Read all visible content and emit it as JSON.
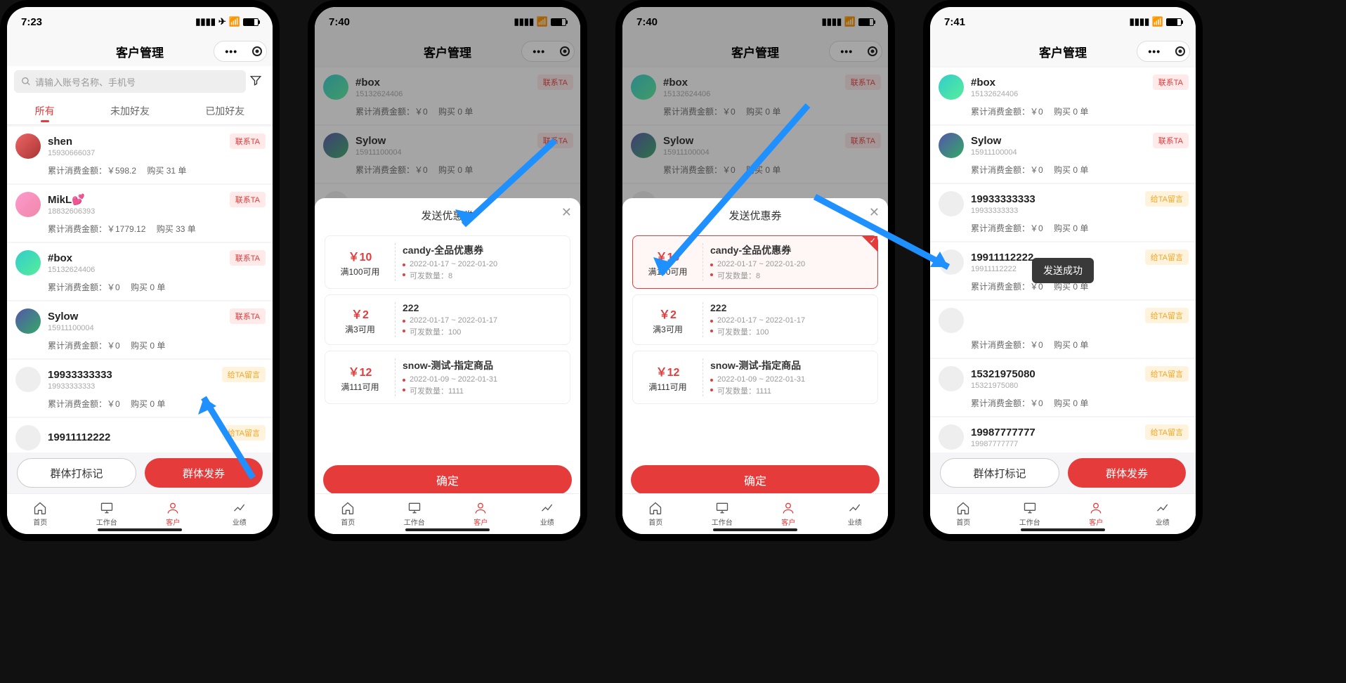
{
  "page_title": "客户管理",
  "statusbar": {
    "times": [
      "7:23",
      "7:40",
      "7:40",
      "7:41"
    ]
  },
  "search": {
    "placeholder": "请输入账号名称、手机号"
  },
  "tabs": {
    "all": "所有",
    "not_friend": "未加好友",
    "friend": "已加好友"
  },
  "badges": {
    "contact": "联系TA",
    "message": "给TA留言"
  },
  "sum_labels": {
    "spend": "累计消费金额：",
    "orders_prefix": "购买 ",
    "orders_suffix": " 单"
  },
  "bottom_buttons": {
    "tag": "群体打标记",
    "send": "群体发券"
  },
  "tabbar": {
    "home": "首页",
    "workbench": "工作台",
    "customer": "客户",
    "performance": "业绩"
  },
  "sheet": {
    "title": "发送优惠券",
    "confirm": "确定"
  },
  "toast": "发送成功",
  "currency": "￥",
  "coupon_prefix": "满",
  "coupon_suffix": "可用",
  "coupon_meta": {
    "date_label_sep": "~",
    "qty_label": "可发数量："
  },
  "customers_s1": [
    {
      "name": "shen",
      "phone": "15930666037",
      "spend": "598.2",
      "orders": "31",
      "badge": "contact",
      "avatar": "c1"
    },
    {
      "name": "MikL💕",
      "phone": "18832606393",
      "spend": "1779.12",
      "orders": "33",
      "badge": "contact",
      "avatar": "c2"
    },
    {
      "name": "#box",
      "phone": "15132624406",
      "spend": "0",
      "orders": "0",
      "badge": "contact",
      "avatar": "c3"
    },
    {
      "name": "Sylow",
      "phone": "15911100004",
      "spend": "0",
      "orders": "0",
      "badge": "contact",
      "avatar": "c4"
    },
    {
      "name": "19933333333",
      "phone": "19933333333",
      "spend": "0",
      "orders": "0",
      "badge": "message",
      "avatar": "c5"
    },
    {
      "name": "19911112222",
      "phone": "",
      "spend": "",
      "orders": "",
      "badge": "message",
      "avatar": "c5"
    }
  ],
  "customers_bg": [
    {
      "name": "#box",
      "phone": "15132624406",
      "spend": "0",
      "orders": "0",
      "badge": "contact",
      "avatar": "c3"
    },
    {
      "name": "Sylow",
      "phone": "15911100004",
      "spend": "0",
      "orders": "0",
      "badge": "contact",
      "avatar": "c4"
    },
    {
      "name": "19933333333",
      "phone": "",
      "spend": "",
      "orders": "",
      "badge": "",
      "avatar": "c5"
    }
  ],
  "customers_s4": [
    {
      "name": "#box",
      "phone": "15132624406",
      "spend": "0",
      "orders": "0",
      "badge": "contact",
      "avatar": "c3"
    },
    {
      "name": "Sylow",
      "phone": "15911100004",
      "spend": "0",
      "orders": "0",
      "badge": "contact",
      "avatar": "c4"
    },
    {
      "name": "19933333333",
      "phone": "19933333333",
      "spend": "0",
      "orders": "0",
      "badge": "message",
      "avatar": "c5"
    },
    {
      "name": "19911112222",
      "phone": "19911112222",
      "spend": "0",
      "orders": "0",
      "badge": "message",
      "avatar": "c5"
    },
    {
      "name": "",
      "phone": "",
      "spend": "0",
      "orders": "0",
      "badge": "message",
      "avatar": "c5"
    },
    {
      "name": "15321975080",
      "phone": "15321975080",
      "spend": "0",
      "orders": "0",
      "badge": "message",
      "avatar": "c5"
    },
    {
      "name": "19987777777",
      "phone": "19987777777",
      "spend": "",
      "orders": "",
      "badge": "message",
      "avatar": "c5"
    }
  ],
  "coupons": [
    {
      "amount": "10",
      "cond": "100",
      "name": "candy-全品优惠券",
      "date": "2022-01-17 ~ 2022-01-20",
      "qty": "8"
    },
    {
      "amount": "2",
      "cond": "3",
      "name": "222",
      "date": "2022-01-17 ~ 2022-01-17",
      "qty": "100"
    },
    {
      "amount": "12",
      "cond": "111",
      "name": "snow-测试-指定商品",
      "date": "2022-01-09 ~ 2022-01-31",
      "qty": "1111"
    }
  ]
}
